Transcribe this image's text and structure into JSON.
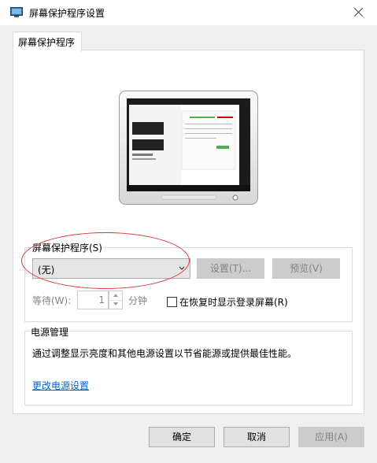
{
  "window": {
    "title": "屏幕保护程序设置"
  },
  "tabs": [
    {
      "label": "屏幕保护程序"
    }
  ],
  "screensaver": {
    "group_label": "屏幕保护程序(S)",
    "selected": "(无)",
    "settings_label": "设置(T)...",
    "preview_label": "预览(V)",
    "wait_label": "等待(W):",
    "wait_value": "1",
    "minutes_label": "分钟",
    "resume_checkbox_label": "在恢复时显示登录屏幕(R)",
    "resume_checked": false
  },
  "power": {
    "group_label": "电源管理",
    "description": "通过调整显示亮度和其他电源设置以节省能源或提供最佳性能。",
    "link_label": "更改电源设置"
  },
  "footer": {
    "ok_label": "确定",
    "cancel_label": "取消",
    "apply_label": "应用(A)"
  },
  "colors": {
    "accent_link": "#0066cc",
    "annotation": "#d9343a",
    "disabled_text": "#838383"
  }
}
